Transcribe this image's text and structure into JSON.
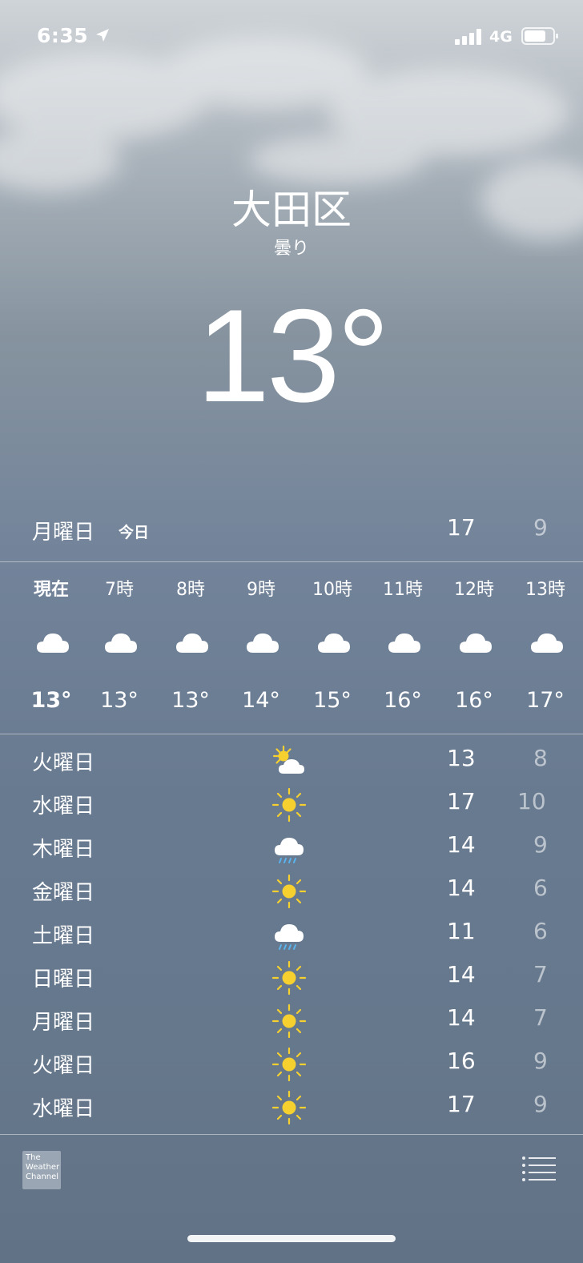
{
  "status_bar": {
    "time": "6:35",
    "network": "4G"
  },
  "location": {
    "city": "大田区",
    "condition": "曇り",
    "temperature": "13°"
  },
  "today": {
    "day": "月曜日",
    "label": "今日",
    "high": "17",
    "low": "9"
  },
  "hourly": [
    {
      "label": "現在",
      "icon": "cloud-icon",
      "temp": "13°"
    },
    {
      "label": "7時",
      "icon": "cloud-icon",
      "temp": "13°"
    },
    {
      "label": "8時",
      "icon": "cloud-icon",
      "temp": "13°"
    },
    {
      "label": "9時",
      "icon": "cloud-icon",
      "temp": "14°"
    },
    {
      "label": "10時",
      "icon": "cloud-icon",
      "temp": "15°"
    },
    {
      "label": "11時",
      "icon": "cloud-icon",
      "temp": "16°"
    },
    {
      "label": "12時",
      "icon": "cloud-icon",
      "temp": "16°"
    },
    {
      "label": "13時",
      "icon": "cloud-icon",
      "temp": "17°"
    }
  ],
  "daily": [
    {
      "day": "火曜日",
      "icon": "partly-cloudy-icon",
      "high": "13",
      "low": "8"
    },
    {
      "day": "水曜日",
      "icon": "sun-icon",
      "high": "17",
      "low": "10"
    },
    {
      "day": "木曜日",
      "icon": "rain-icon",
      "high": "14",
      "low": "9"
    },
    {
      "day": "金曜日",
      "icon": "sun-icon",
      "high": "14",
      "low": "6"
    },
    {
      "day": "土曜日",
      "icon": "rain-icon",
      "high": "11",
      "low": "6"
    },
    {
      "day": "日曜日",
      "icon": "sun-icon",
      "high": "14",
      "low": "7"
    },
    {
      "day": "月曜日",
      "icon": "sun-icon",
      "high": "14",
      "low": "7"
    },
    {
      "day": "火曜日",
      "icon": "sun-icon",
      "high": "16",
      "low": "9"
    },
    {
      "day": "水曜日",
      "icon": "sun-icon",
      "high": "17",
      "low": "9"
    }
  ],
  "footer": {
    "logo_text": "The Weather Channel"
  },
  "colors": {
    "sun": "#f6d02f",
    "rain": "#5ab4ee",
    "cloud": "#ffffff"
  }
}
